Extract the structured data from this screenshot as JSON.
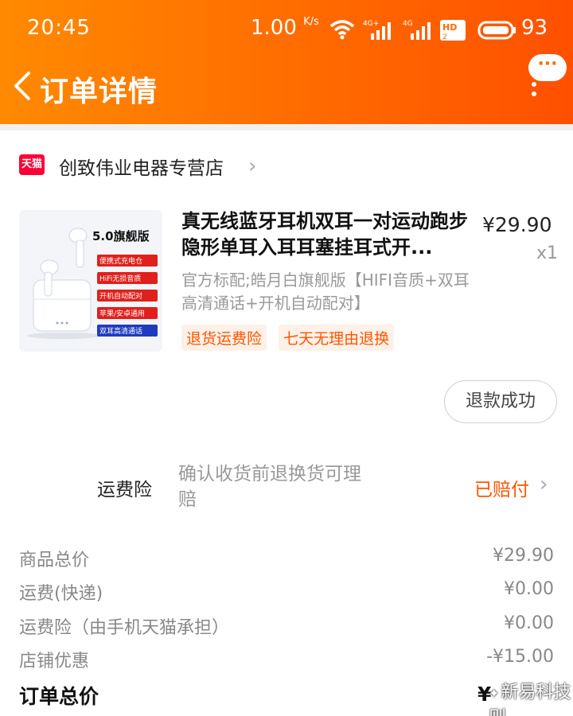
{
  "status_bar": {
    "time": "20:45",
    "speed_value": "1.00",
    "speed_unit": "K/s",
    "battery": "93"
  },
  "header": {
    "title": "订单详情",
    "more_label": "···"
  },
  "store": {
    "logo_text": "天猫",
    "name": "创致伟业电器专营店",
    "chevron": "›"
  },
  "product": {
    "title": "真无线蓝牙耳机双耳一对运动跑步隐形单耳入耳耳塞挂耳式开...",
    "price": "¥29.90",
    "qty": "x1",
    "sku": "官方标配;皓月白旗舰版【HIFI音质+双耳高清通话+开机自动配对】",
    "tags": [
      "退货运费险",
      "七天无理由退换"
    ],
    "thumb": {
      "badge": "5.0旗舰版",
      "features": [
        "便携式充电仓",
        "HiFi无损音质",
        "开机自动配对",
        "苹果/安卓通用",
        "双耳高清通话"
      ]
    }
  },
  "refund_button": "退款成功",
  "insurance": {
    "label": "运费险",
    "desc": "确认收货前退换货可理赔",
    "status": "已赔付",
    "chevron": "›"
  },
  "summary": {
    "rows": [
      {
        "label": "商品总价",
        "value": "¥29.90"
      },
      {
        "label": "运费(快递)",
        "value": "¥0.00"
      },
      {
        "label": "运费险（由手机天猫承担）",
        "value": "¥0.00"
      },
      {
        "label": "店铺优惠",
        "value": "-¥15.00"
      }
    ],
    "total_label": "订单总价",
    "total_value": "¥"
  },
  "watermark": "新易科技则",
  "colors": {
    "header_start": "#ff8a00",
    "header_end": "#ff5000",
    "accent": "#ff5500",
    "tmall_red": "#ff0036"
  },
  "icons": [
    "back-arrow-icon",
    "wifi-icon",
    "signal-4g-icon",
    "hd-icon",
    "battery-icon",
    "more-icon",
    "tmall-logo",
    "chevron-right-icon"
  ]
}
